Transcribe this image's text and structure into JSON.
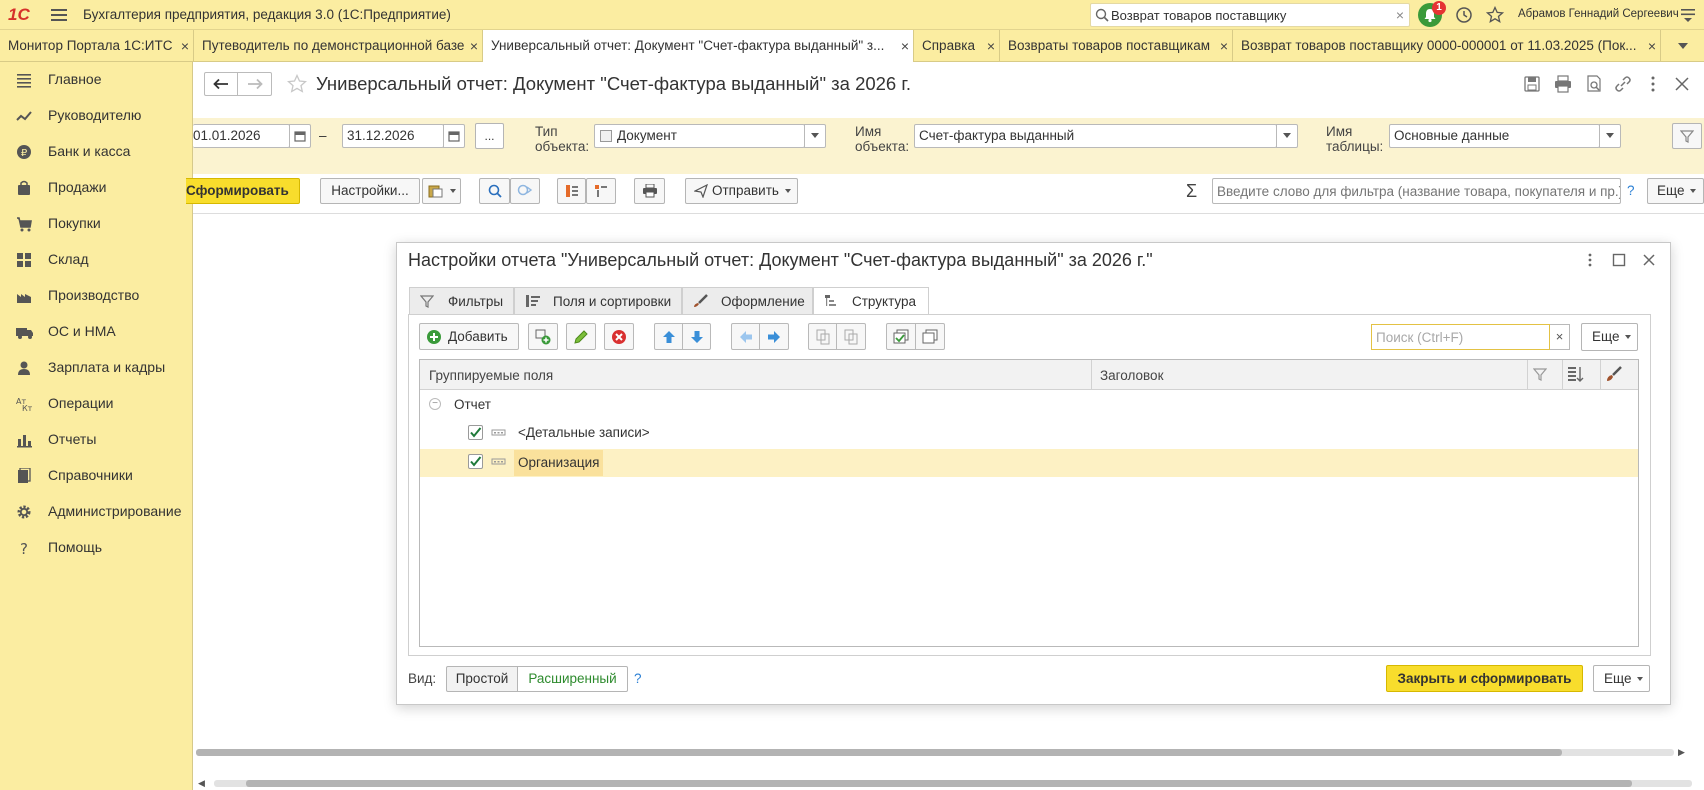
{
  "app": {
    "title": "Бухгалтерия предприятия, редакция 3.0  (1С:Предприятие)",
    "logo": "1С",
    "search_value": "Возврат товаров поставщику",
    "notifications": "1",
    "user": "Абрамов Геннадий Сергеевич"
  },
  "tabs": [
    {
      "label": "Монитор Портала 1С:ИТС"
    },
    {
      "label": "Путеводитель по демонстрационной базе"
    },
    {
      "label": "Универсальный отчет: Документ \"Счет-фактура выданный\" з..."
    },
    {
      "label": "Справка"
    },
    {
      "label": "Возвраты товаров поставщикам"
    },
    {
      "label": "Возврат товаров поставщику 0000-000001 от 11.03.2025 (Пок..."
    }
  ],
  "sidebar": {
    "items": [
      {
        "label": "Главное",
        "icon": "menu-lines-icon"
      },
      {
        "label": "Руководителю",
        "icon": "trend-icon"
      },
      {
        "label": "Банк и касса",
        "icon": "coin-icon"
      },
      {
        "label": "Продажи",
        "icon": "bag-icon"
      },
      {
        "label": "Покупки",
        "icon": "cart-icon"
      },
      {
        "label": "Склад",
        "icon": "grid-icon"
      },
      {
        "label": "Производство",
        "icon": "factory-icon"
      },
      {
        "label": "ОС и НМА",
        "icon": "truck-icon"
      },
      {
        "label": "Зарплата и кадры",
        "icon": "person-icon"
      },
      {
        "label": "Операции",
        "icon": "operations-icon"
      },
      {
        "label": "Отчеты",
        "icon": "bar-chart-icon"
      },
      {
        "label": "Справочники",
        "icon": "books-icon"
      },
      {
        "label": "Администрирование",
        "icon": "gear-icon"
      },
      {
        "label": "Помощь",
        "icon": "question-icon"
      }
    ]
  },
  "page": {
    "title": "Универсальный отчет: Документ \"Счет-фактура выданный\" за 2026 г."
  },
  "params": {
    "date_from": "01.01.2026",
    "date_to": "31.12.2026",
    "dash": "–",
    "ellipsis": "...",
    "object_type_label_1": "Тип",
    "object_type_label_2": "объекта:",
    "object_type": "Документ",
    "object_name_label_1": "Имя",
    "object_name_label_2": "объекта:",
    "object_name": "Счет-фактура выданный",
    "table_name_label_1": "Имя",
    "table_name_label_2": "таблицы:",
    "table_name": "Основные данные"
  },
  "toolbar": {
    "generate": "Сформировать",
    "settings": "Настройки...",
    "send": "Отправить",
    "filter_placeholder": "Введите слово для фильтра (название товара, покупателя и пр.)",
    "help": "?",
    "more": "Еще"
  },
  "dialog": {
    "title": "Настройки отчета \"Универсальный отчет: Документ \"Счет-фактура выданный\" за 2026 г.\"",
    "tabs": [
      {
        "label": "Фильтры"
      },
      {
        "label": "Поля и сортировки"
      },
      {
        "label": "Оформление"
      },
      {
        "label": "Структура"
      }
    ],
    "add": "Добавить",
    "search_placeholder": "Поиск (Ctrl+F)",
    "search_clear": "×",
    "more": "Еще",
    "columns": {
      "grouped": "Группируемые поля",
      "header": "Заголовок"
    },
    "rows": [
      {
        "label": "Отчет",
        "level": 0
      },
      {
        "label": "<Детальные записи>",
        "level": 1,
        "checked": true
      },
      {
        "label": "Организация",
        "level": 1,
        "checked": true,
        "selected": true
      }
    ],
    "view_label": "Вид:",
    "view_simple": "Простой",
    "view_extended": "Расширенный",
    "view_help": "?",
    "close_generate": "Закрыть и сформировать",
    "footer_more": "Еще"
  },
  "colors": {
    "panel_yellow": "#fbeda1",
    "accent_yellow": "#f8dd2c",
    "selected_row": "#fdf1c4",
    "link_green": "#2e8b2e",
    "link_blue": "#2a7fd4"
  }
}
